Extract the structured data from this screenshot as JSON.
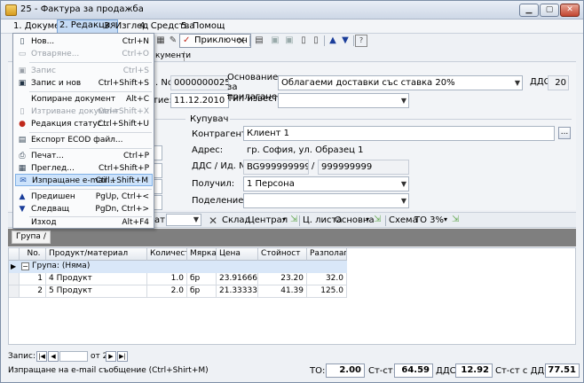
{
  "window": {
    "title": "25 - Фактура за продажба"
  },
  "menubar": [
    "1. Документ",
    "2. Редакция",
    "3. Изглед",
    "4. Средства",
    "5. Помощ"
  ],
  "toolbar": {
    "prikl_label": "Приключен"
  },
  "tab": {
    "label": "кументи"
  },
  "header": {
    "no_label": ". No.",
    "no_value": "0000000025",
    "date_label": "тие:",
    "date_value": "11.12.2010",
    "basis_label": "Основание за прилагане:",
    "basis_value": "Облагаеми доставки със ставка 20%",
    "vat_label": "ДДС:",
    "vat_value": "20",
    "notice_label": "Тип известие:"
  },
  "buyer": {
    "group_label": "Купувач",
    "contragent_label": "Контрагент:",
    "contragent_value": "Клиент 1",
    "address_label": "Адрес:",
    "address_value": "гр. София, ул. Образец 1",
    "vatid_label": "ДДС / Ид. No.",
    "vat_no": "BG999999999",
    "slash": "/",
    "id_no": "999999999",
    "receiver_label": "Получил:",
    "receiver_value": "1 Персона",
    "division_label": "Поделение:"
  },
  "subtoolbar": {
    "format_label": "ат:",
    "warehouse_label": "Склад",
    "warehouse_value": "Централ",
    "pricelist_label": "Ц. листа",
    "pricelist_value": "Основна",
    "scheme_label": "Схема",
    "scheme_value": "ТО 3%"
  },
  "group_chip": "Група",
  "grid": {
    "headers": [
      "No.",
      "Продукт/материал",
      "Количест...",
      "Мярка",
      "Цена",
      "Стойност",
      "Разполаг..."
    ],
    "group_row": "Група: (Няма)",
    "rows": [
      {
        "no": "1",
        "product": "4 Продукт",
        "qty": "1.0",
        "unit": "бр",
        "price": "23.916666...",
        "value": "23.20",
        "avail": "32.0"
      },
      {
        "no": "2",
        "product": "5 Продукт",
        "qty": "2.0",
        "unit": "бр",
        "price": "21.333333...",
        "value": "41.39",
        "avail": "125.0"
      }
    ]
  },
  "nav": {
    "record_label": "Запис:",
    "of_label": "от 2"
  },
  "status": {
    "hint": "Изпращане на e-mail съобщение (Ctrl+Shirt+M)",
    "to_label": "ТО:",
    "to_value": "2.00",
    "cost_label": "Ст-ст:",
    "cost_value": "64.59",
    "vat_label": "ДДС:",
    "vat_value": "12.92",
    "total_label": "Ст-ст с ДДС:",
    "total_value": "77.51"
  },
  "menu": {
    "items": [
      {
        "icon": "new-doc-icon",
        "label": "Нов...",
        "shortcut": "Ctrl+N",
        "disabled": false
      },
      {
        "icon": "open-icon",
        "label": "Отваряне...",
        "shortcut": "Ctrl+O",
        "disabled": true
      },
      {
        "icon": "save-icon",
        "label": "Запис",
        "shortcut": "Ctrl+S",
        "disabled": true
      },
      {
        "icon": "save-new-icon",
        "label": "Запис и нов",
        "shortcut": "Ctrl+Shift+S",
        "disabled": false
      },
      {
        "icon": "copy-doc-icon",
        "label": "Копиране документ",
        "shortcut": "Alt+C",
        "disabled": false
      },
      {
        "icon": "delete-doc-icon",
        "label": "Изтриване документ",
        "shortcut": "Ctrl+Shift+X",
        "disabled": true
      },
      {
        "icon": "traffic-light-icon",
        "label": "Редакция статус...",
        "shortcut": "Ctrl+Shift+U",
        "disabled": false
      },
      {
        "icon": "export-icon",
        "label": "Експорт ECOD файл...",
        "shortcut": "",
        "disabled": false
      },
      {
        "icon": "print-icon",
        "label": "Печат...",
        "shortcut": "Ctrl+P",
        "disabled": false
      },
      {
        "icon": "preview-icon",
        "label": "Преглед...",
        "shortcut": "Ctrl+Shift+P",
        "disabled": false
      },
      {
        "icon": "email-icon",
        "label": "Изпращане e-mail...",
        "shortcut": "Ctrl+Shift+M",
        "disabled": false
      },
      {
        "icon": "arrow-up-icon",
        "label": "Предишен",
        "shortcut": "PgUp, Ctrl+<",
        "disabled": false
      },
      {
        "icon": "arrow-down-icon",
        "label": "Следващ",
        "shortcut": "PgDn, Ctrl+>",
        "disabled": false
      },
      {
        "icon": "exit-icon",
        "label": "Изход",
        "shortcut": "Alt+F4",
        "disabled": false
      }
    ]
  }
}
